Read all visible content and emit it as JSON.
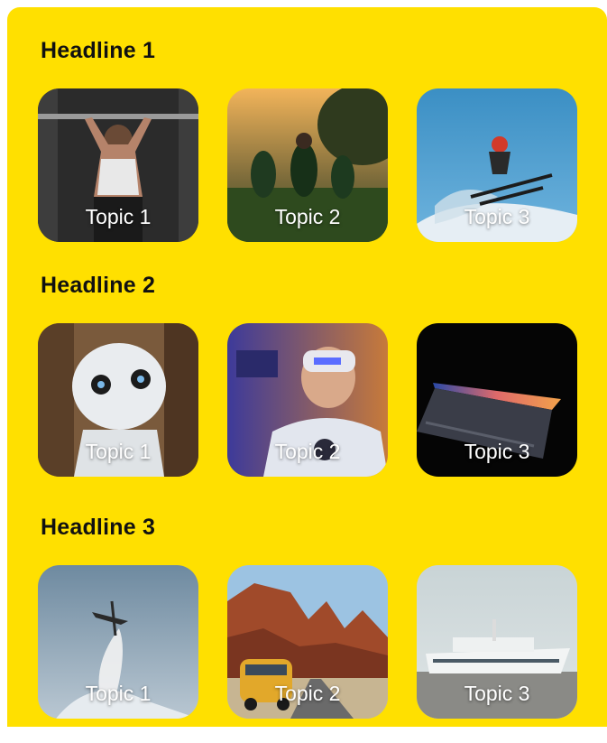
{
  "colors": {
    "panel": "#FFE000",
    "headline": "#111111",
    "label": "#FFFFFF"
  },
  "sections": [
    {
      "headline": "Headline 1",
      "tiles": [
        {
          "label": "Topic 1",
          "image": "gym-weightlifter-photo"
        },
        {
          "label": "Topic 2",
          "image": "rugby-players-photo"
        },
        {
          "label": "Topic 3",
          "image": "skier-jump-photo"
        }
      ]
    },
    {
      "headline": "Headline 2",
      "tiles": [
        {
          "label": "Topic 1",
          "image": "robot-photo"
        },
        {
          "label": "Topic 2",
          "image": "vr-headset-person-photo"
        },
        {
          "label": "Topic 3",
          "image": "laptop-dark-photo"
        }
      ]
    },
    {
      "headline": "Headline 3",
      "tiles": [
        {
          "label": "Topic 1",
          "image": "airshow-planes-photo"
        },
        {
          "label": "Topic 2",
          "image": "desert-van-road-photo"
        },
        {
          "label": "Topic 3",
          "image": "cruise-ship-photo"
        }
      ]
    }
  ]
}
